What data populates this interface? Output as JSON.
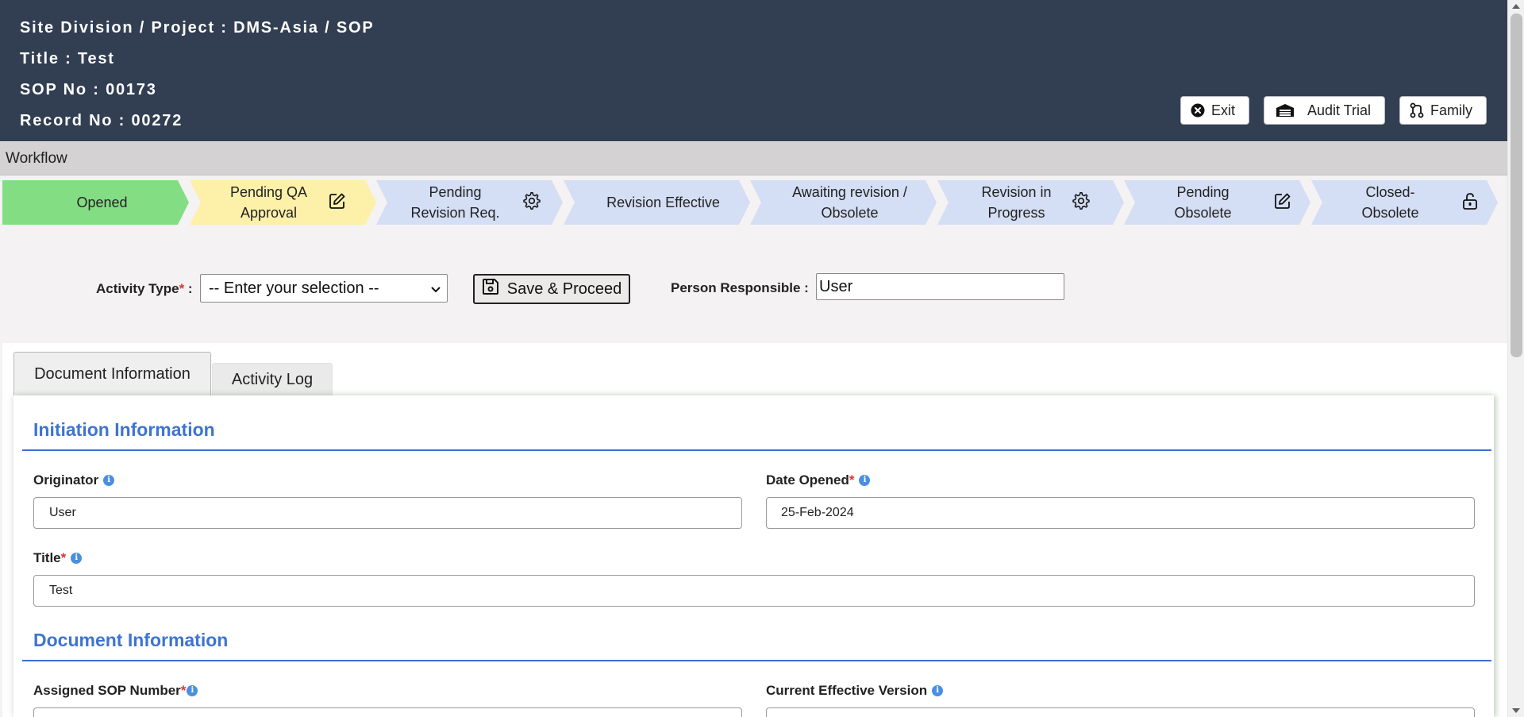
{
  "header": {
    "site_line": "Site Division / Project : DMS-Asia / SOP",
    "title_line": "Title : Test",
    "sop_line": "SOP No : 00173",
    "record_line": "Record No : 00272",
    "buttons": {
      "exit": "Exit",
      "audit": "Audit Trial",
      "family": "Family"
    }
  },
  "workflow": {
    "title": "Workflow",
    "stages": [
      {
        "label": "Opened",
        "color": "#83de83",
        "icon": ""
      },
      {
        "label": "Pending QA Approval",
        "color": "#fdf0a9",
        "icon": "edit-icon"
      },
      {
        "label": "Pending Revision Req.",
        "color": "#d4def4",
        "icon": "gear-icon"
      },
      {
        "label": "Revision Effective",
        "color": "#d4def4",
        "icon": ""
      },
      {
        "label": "Awaiting revision / Obsolete",
        "color": "#d4def4",
        "icon": ""
      },
      {
        "label": "Revision in Progress",
        "color": "#d4def4",
        "icon": "gear-icon"
      },
      {
        "label": "Pending Obsolete",
        "color": "#d4def4",
        "icon": "edit-icon"
      },
      {
        "label": "Closed- Obsolete",
        "color": "#d4def4",
        "icon": "unlock-icon"
      }
    ]
  },
  "activity": {
    "label": "Activity Type",
    "required_mark": "*",
    "colon": " :",
    "select_value": "-- Enter your selection --",
    "save_label": "Save & Proceed",
    "person_label": "Person Responsible :",
    "person_value": "User"
  },
  "tabs": {
    "document_information": "Document Information",
    "activity_log": "Activity Log"
  },
  "sections": {
    "initiation": "Initiation Information",
    "document": "Document Information"
  },
  "fields": {
    "originator": {
      "label": "Originator",
      "value": "User"
    },
    "date_opened": {
      "label": "Date Opened",
      "required_mark": "*",
      "value": "25-Feb-2024"
    },
    "title": {
      "label": "Title",
      "required_mark": "*",
      "value": "Test"
    },
    "assigned_sop": {
      "label": "Assigned SOP Number",
      "required_mark": "*"
    },
    "current_version": {
      "label": "Current Effective Version"
    }
  },
  "colors": {
    "header_bg": "#323e52",
    "accent_blue": "#3e74d0",
    "required_red": "#e03434"
  }
}
